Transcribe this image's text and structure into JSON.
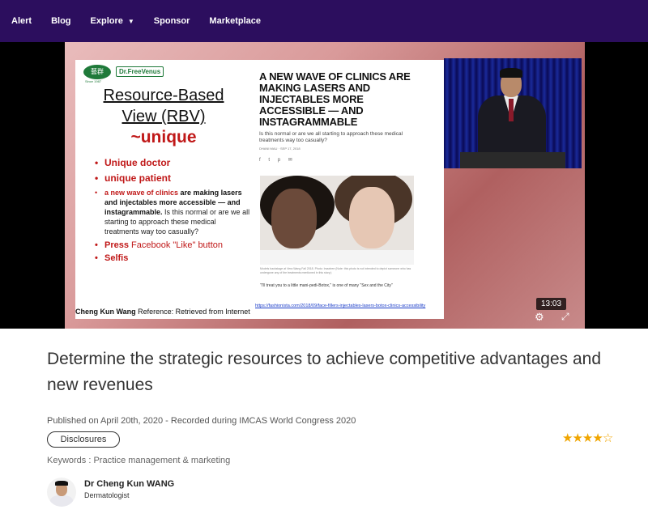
{
  "nav": {
    "items": [
      "Alert",
      "Blog",
      "Explore",
      "Sponsor",
      "Marketplace"
    ],
    "explore_caret": "▼"
  },
  "video": {
    "duration": "13:03",
    "slide": {
      "logo_a": "藝群",
      "logo_a_sub": "Since 1987",
      "logo_b": "Dr.FreeVenus",
      "title": "Resource-Based View (RBV)",
      "unique": "~unique",
      "bullet_1": "Unique doctor",
      "bullet_2": "unique patient",
      "bullet_3_red": "a new wave of clinics",
      "bullet_3_bold": " are making lasers and injectables more accessible — and instagrammable.",
      "bullet_3_rest": " Is this normal or are we all starting to approach these medical treatments way too casually?",
      "bullet_4_red": "Press ",
      "bullet_4_plain": "Facebook \"Like\" button",
      "bullet_5": "Selfis",
      "footer_name": "Cheng Kun Wang",
      "footer_ref": "  Reference: Retrieved from Internet",
      "article_title": "A NEW WAVE OF CLINICS ARE MAKING LASERS AND INJECTABLES MORE ACCESSIBLE — AND INSTAGRAMMABLE",
      "article_sub": "Is this normal or are we all starting to approach these medical treatments way too casually?",
      "article_by": "DHANI MAU · SEP 17, 2018",
      "share_icons": [
        "f",
        "t",
        "p",
        "✉"
      ],
      "article_caption": "Models backstage at Vera Wang Fall 2018. Photo: Imaxtree (Note: this photo is not intended to depict someone who has undergone any of the treatments mentioned in this story.)",
      "article_quote": "\"I'll treat you to a little mani-pedi-Botox,\" is one of many \"Sex and the City\"",
      "article_link": "https://fashionista.com/2018/09/face-fillers-injectables-lasers-botox-clinics-accessibility"
    }
  },
  "content": {
    "title": "Determine the strategic resources to achieve competitive advantages and new revenues",
    "published": "Published on April 20th, 2020 - Recorded during IMCAS World Congress 2020",
    "disclosures_label": "Disclosures",
    "rating": 4,
    "rating_max": 5,
    "rating_color": "#f0a500",
    "keywords": "Keywords : Practice management & marketing",
    "doctor_name": "Dr Cheng Kun WANG",
    "doctor_role": "Dermatologist"
  },
  "colors": {
    "nav_bg": "#2c0e5e",
    "slide_red": "#c01818"
  }
}
